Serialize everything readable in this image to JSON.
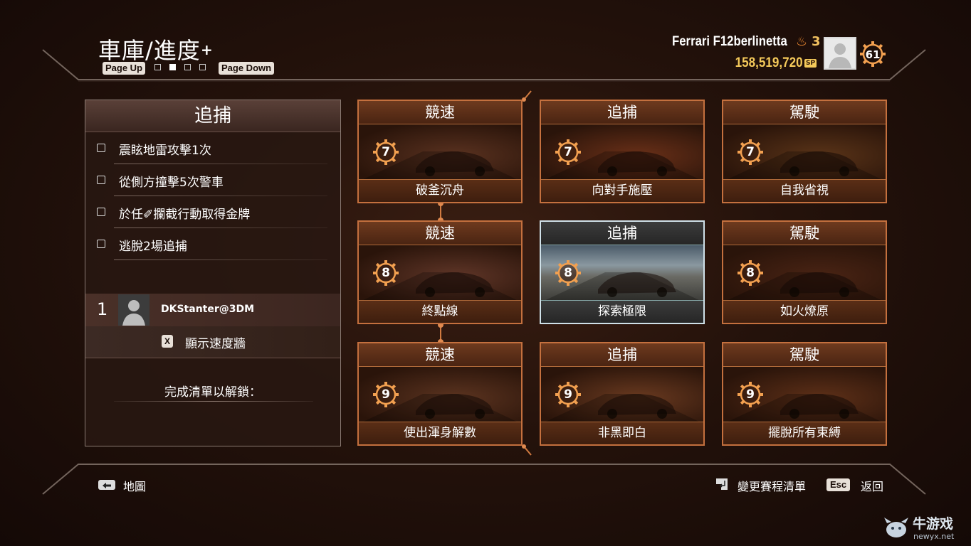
{
  "header": {
    "title": "車庫/進度",
    "page_up_label": "Page Up",
    "page_down_label": "Page Down",
    "page_dots": 4,
    "active_page": 2,
    "car_name": "Ferrari F12berlinetta",
    "heat_level": "3",
    "sp_amount": "158,519,720",
    "sp_unit": "SP",
    "player_level": "61"
  },
  "left_panel": {
    "title": "追捕",
    "objectives": [
      {
        "label": "震眩地雷攻擊1次",
        "done": false
      },
      {
        "label": "從側方撞擊5次警車",
        "done": false
      },
      {
        "label": "於任✐攔截行動取得金牌",
        "done": false
      },
      {
        "label": "逃脫2場追捕",
        "done": false
      }
    ],
    "leaderboard": {
      "rank": "1",
      "player": "DKStanter@3DM"
    },
    "speedwall_key": "X",
    "speedwall_label": "顯示速度牆",
    "unlock_label": "完成清單以解鎖："
  },
  "events": [
    {
      "category": "競速",
      "tier": "7",
      "name": "破釜沉舟",
      "selected": false,
      "tone": "#5a3220"
    },
    {
      "category": "追捕",
      "tier": "7",
      "name": "向對手施壓",
      "selected": false,
      "tone": "#6a3018"
    },
    {
      "category": "駕駛",
      "tier": "7",
      "name": "自我省視",
      "selected": false,
      "tone": "#5a3418"
    },
    {
      "category": "競速",
      "tier": "8",
      "name": "終點線",
      "selected": false,
      "tone": "#603628"
    },
    {
      "category": "追捕",
      "tier": "8",
      "name": "探索極限",
      "selected": true,
      "tone": "#6a6e70"
    },
    {
      "category": "駕駛",
      "tier": "8",
      "name": "如火燎原",
      "selected": false,
      "tone": "#4a2414"
    },
    {
      "category": "競速",
      "tier": "9",
      "name": "使出渾身解數",
      "selected": false,
      "tone": "#5c3420"
    },
    {
      "category": "追捕",
      "tier": "9",
      "name": "非黑即白",
      "selected": false,
      "tone": "#6a3a20"
    },
    {
      "category": "駕駛",
      "tier": "9",
      "name": "擺脫所有束縛",
      "selected": false,
      "tone": "#5e3018"
    }
  ],
  "footer": {
    "map_label": "地圖",
    "change_label": "變更賽程清單",
    "esc_key": "Esc",
    "back_label": "返回"
  },
  "watermark": {
    "text": "牛游戏",
    "url": "newyx.net"
  },
  "colors": {
    "accent": "#d07a40",
    "gold": "#f4c95a",
    "selected_border": "#cfe0e8"
  }
}
